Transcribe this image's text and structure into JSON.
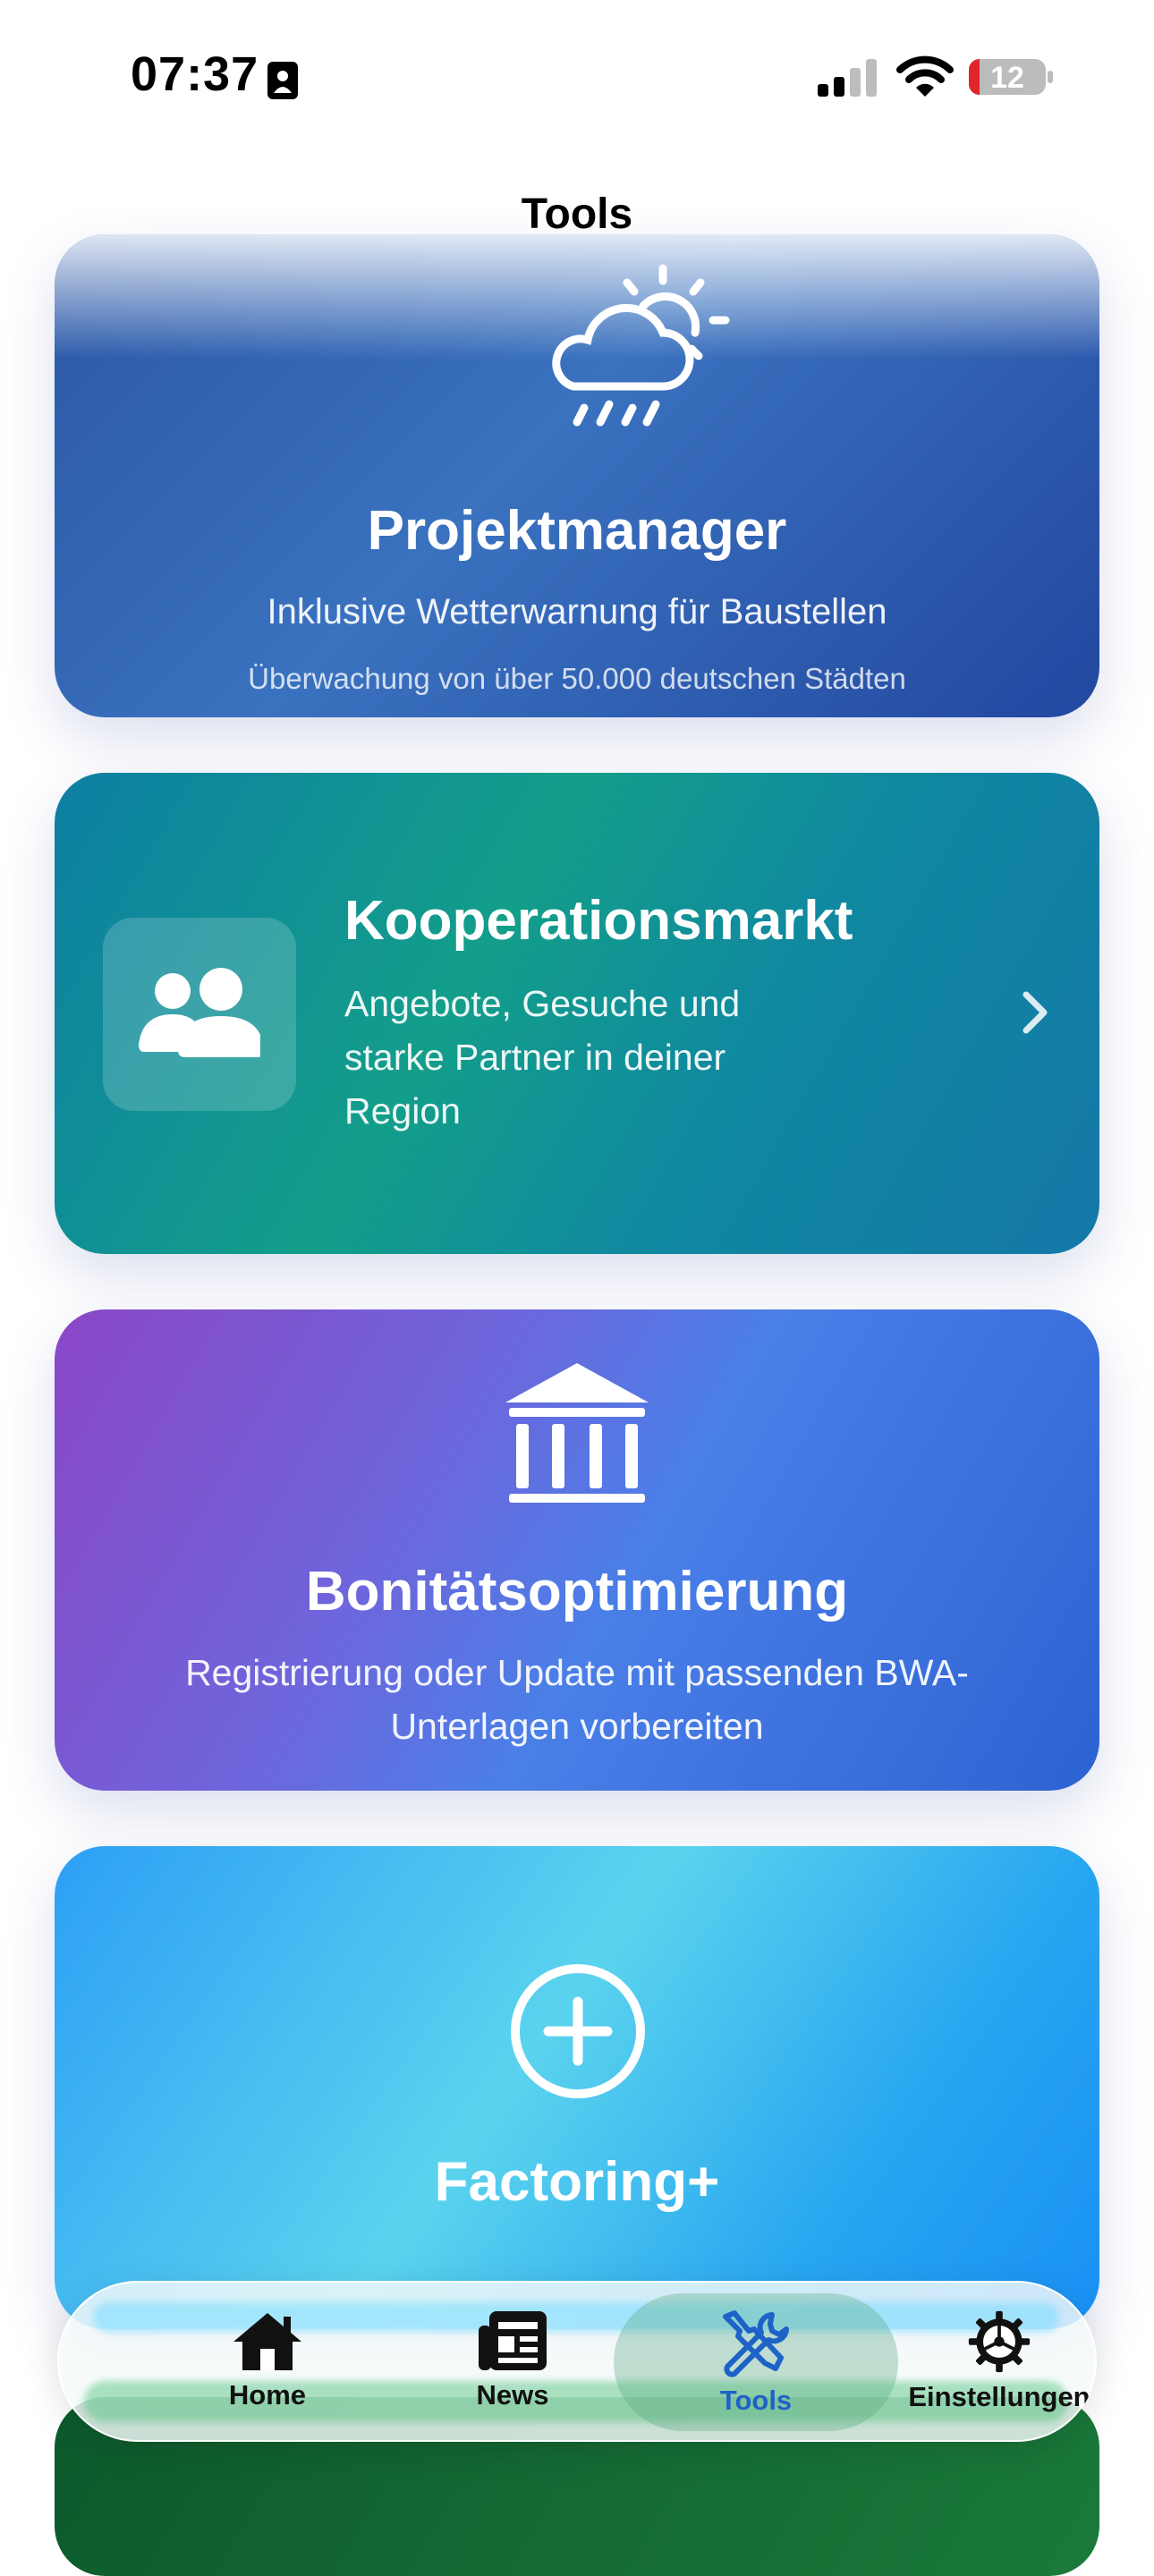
{
  "status_bar": {
    "time": "07:37",
    "battery": "12"
  },
  "page": {
    "title": "Tools"
  },
  "cards": [
    {
      "title": "Projektmanager",
      "subtitle": "Inklusive Wetterwarnung für Baustellen",
      "note": "Überwachung von über 50.000 deutschen Städten",
      "icon": "cloud-sun-rain-icon"
    },
    {
      "title": "Kooperationsmarkt",
      "description": "Angebote, Gesuche und starke Partner in deiner Region",
      "icon": "people-icon"
    },
    {
      "title": "Bonitätsoptimierung",
      "description": "Registrierung oder Update mit passenden BWA-Unterlagen vorbereiten",
      "icon": "bank-icon"
    },
    {
      "title": "Factoring+",
      "icon": "plus-circle-icon"
    }
  ],
  "tabbar": {
    "active": "Tools",
    "tabs": [
      {
        "label": "Home",
        "icon": "house-icon"
      },
      {
        "label": "News",
        "icon": "newspaper-icon"
      },
      {
        "label": "Tools",
        "icon": "wrench-screwdriver-icon"
      },
      {
        "label": "Einstellungen",
        "icon": "gear-icon"
      }
    ]
  },
  "colors": {
    "accent": "#1e62c8",
    "card1": "#2a56a6",
    "card2": "#139e8a",
    "card3": "#6e66dc",
    "card4": "#2d9ff5"
  }
}
